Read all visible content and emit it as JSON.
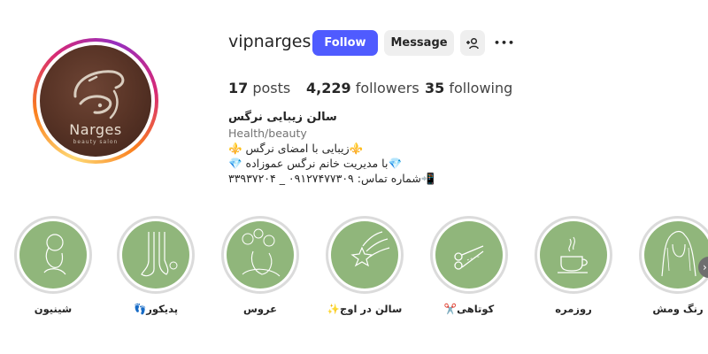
{
  "profile": {
    "username": "vipnarges",
    "avatar_brand": "Narges",
    "avatar_sub": "beauty salon"
  },
  "actions": {
    "follow_label": "Follow",
    "message_label": "Message",
    "suggest_icon": "add-person-icon",
    "more_icon": "more-horizontal-icon",
    "more_glyph": "•••"
  },
  "stats": {
    "posts_count": "17",
    "posts_label": "posts",
    "followers_count": "4,229",
    "followers_label": "followers",
    "following_count": "35",
    "following_label": "following"
  },
  "bio": {
    "name": "سالن زیبایی نرگس",
    "category": "Health/beauty",
    "line1": "⚜️زیبایی با امضای نرگس ⚜️",
    "line2": "💎با مدیریت خانم نرگس عموزاده 💎",
    "line3": "📲شماره تماس: ۰۹۱۲۷۴۷۷۳۰۹ _ ۳۳۹۳۷۲۰۴"
  },
  "highlights": [
    {
      "label": "شینیون",
      "icon": "woman-updo-icon"
    },
    {
      "label": "پدیکور👣",
      "icon": "feet-pedicure-icon"
    },
    {
      "label": "عروس",
      "icon": "bride-flowers-icon"
    },
    {
      "label": "سالن در اوج✨",
      "icon": "shooting-star-icon"
    },
    {
      "label": "کوتاهی✂️",
      "icon": "scissors-icon"
    },
    {
      "label": "روزمره",
      "icon": "coffee-cup-icon"
    },
    {
      "label": "رنگ ومش",
      "icon": "woman-long-hair-icon"
    }
  ],
  "colors": {
    "follow_button": "#4f5bff",
    "highlight_bg": "#90b67b",
    "avatar_bg": "#5a3527"
  }
}
